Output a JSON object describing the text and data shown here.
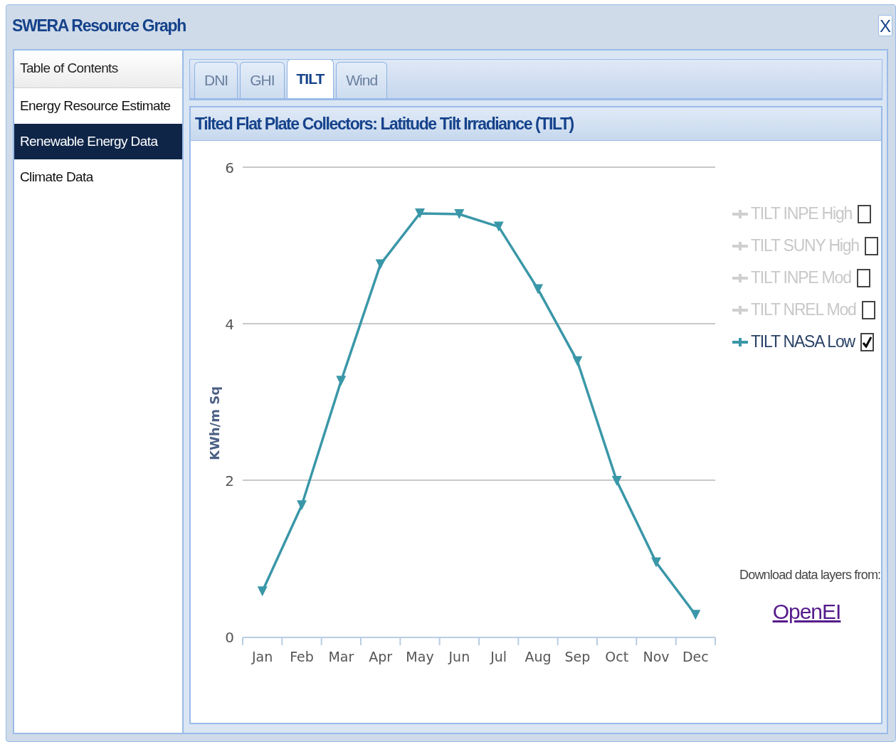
{
  "window": {
    "title": "SWERA Resource Graph",
    "close_label": "X"
  },
  "sidebar": {
    "heading": "Table of Contents",
    "items": [
      {
        "label": "Energy Resource Estimate",
        "selected": false
      },
      {
        "label": "Renewable Energy Data",
        "selected": true
      },
      {
        "label": "Climate Data",
        "selected": false
      }
    ]
  },
  "tabs": [
    {
      "label": "DNI",
      "selected": false
    },
    {
      "label": "GHI",
      "selected": false
    },
    {
      "label": "TILT",
      "selected": true
    },
    {
      "label": "Wind",
      "selected": false
    }
  ],
  "panel": {
    "title": "Tilted Flat Plate Collectors: Latitude Tilt Irradiance (TILT)",
    "chart_data": {
      "type": "line",
      "ylabel": "KWh/m Sq",
      "categories": [
        "Jan",
        "Feb",
        "Mar",
        "Apr",
        "May",
        "Jun",
        "Jul",
        "Aug",
        "Sep",
        "Oct",
        "Nov",
        "Dec"
      ],
      "ylim": [
        0,
        6
      ],
      "yticks": [
        0,
        2,
        4,
        6
      ],
      "series": [
        {
          "name": "TILT NASA Low",
          "color": "#3a97a8",
          "marker": "triangle-down",
          "values": [
            0.58,
            1.68,
            3.27,
            4.76,
            5.41,
            5.4,
            5.24,
            4.44,
            3.52,
            1.99,
            0.95,
            0.28
          ]
        }
      ]
    },
    "legend": [
      {
        "label": "TILT INPE High",
        "checked": false
      },
      {
        "label": "TILT SUNY High",
        "checked": false
      },
      {
        "label": "TILT INPE Mod",
        "checked": false
      },
      {
        "label": "TILT NREL Mod",
        "checked": false
      }
    ],
    "series_legend": [
      {
        "checked": true
      }
    ],
    "download_text": "Download data layers from:",
    "download_link": "OpenEI"
  }
}
